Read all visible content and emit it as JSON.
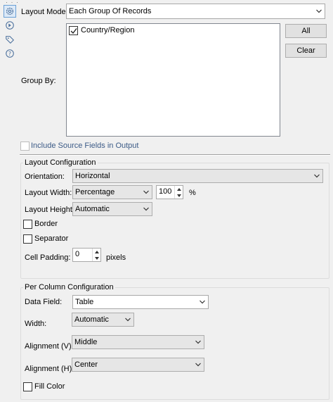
{
  "sidebar": {
    "icons": [
      "gear-icon",
      "cursor-icon",
      "tag-icon",
      "help-icon"
    ]
  },
  "layout_mode": {
    "label": "Layout Mode:",
    "value": "Each Group Of Records"
  },
  "group_by": {
    "label": "Group By:",
    "items": [
      {
        "label": "Country/Region",
        "checked": true
      }
    ],
    "all_button": "All",
    "clear_button": "Clear"
  },
  "include_source": {
    "label": "Include Source Fields in Output",
    "checked": false,
    "enabled": false
  },
  "layout_configuration": {
    "title": "Layout Configuration",
    "orientation": {
      "label": "Orientation:",
      "value": "Horizontal"
    },
    "layout_width": {
      "label": "Layout Width:",
      "value": "Percentage",
      "amount": "100",
      "unit": "%"
    },
    "layout_height": {
      "label": "Layout Height:",
      "value": "Automatic"
    },
    "border": {
      "label": "Border",
      "checked": false
    },
    "separator": {
      "label": "Separator",
      "checked": false
    },
    "cell_padding": {
      "label": "Cell Padding:",
      "value": "0",
      "unit": "pixels"
    }
  },
  "per_column_configuration": {
    "title": "Per Column Configuration",
    "data_field": {
      "label": "Data Field:",
      "value": "Table"
    },
    "width": {
      "label": "Width:",
      "value": "Automatic"
    },
    "alignment_v": {
      "label": "Alignment (V):",
      "value": "Middle"
    },
    "alignment_h": {
      "label": "Alignment (H):",
      "value": "Center"
    },
    "fill_color": {
      "label": "Fill Color",
      "checked": false
    }
  }
}
